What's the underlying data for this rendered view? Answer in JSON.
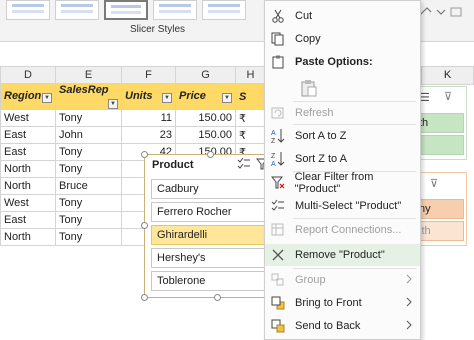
{
  "ribbon": {
    "group_label": "Slicer Styles"
  },
  "grid": {
    "columns": [
      "D",
      "E",
      "F",
      "G",
      "H"
    ],
    "headers": [
      "Region",
      "SalesRep",
      "Units",
      "Price",
      "S"
    ],
    "rows": [
      [
        "West",
        "Tony",
        "11",
        "150.00",
        "₹"
      ],
      [
        "East",
        "John",
        "23",
        "150.00",
        "₹"
      ],
      [
        "East",
        "Tony",
        "42",
        "150.00",
        "₹"
      ],
      [
        "North",
        "Tony",
        "",
        "",
        ""
      ],
      [
        "North",
        "Bruce",
        "",
        "",
        ""
      ],
      [
        "West",
        "Tony",
        "",
        "",
        ""
      ],
      [
        "East",
        "Tony",
        "",
        "",
        ""
      ],
      [
        "North",
        "Tony",
        "",
        "",
        ""
      ]
    ]
  },
  "right_grid": {
    "column": "K"
  },
  "right_slicers": {
    "green_item": "th",
    "orange_item1": "ny",
    "orange_item2": "ith"
  },
  "slicer": {
    "title": "Product",
    "items": [
      "Cadbury",
      "Ferrero Rocher",
      "Ghirardelli",
      "Hershey's",
      "Toblerone"
    ],
    "selected": "Ghirardelli"
  },
  "context_menu": {
    "cut": "Cut",
    "copy": "Copy",
    "paste_options": "Paste Options:",
    "refresh": "Refresh",
    "sort_a_z": "Sort A to Z",
    "sort_z_a": "Sort Z to A",
    "clear_filter": "Clear Filter from \"Product\"",
    "multi_select": "Multi-Select \"Product\"",
    "report_connections": "Report Connections...",
    "remove": "Remove \"Product\"",
    "group": "Group",
    "bring_to_front": "Bring to Front",
    "send_to_back": "Send to Back"
  },
  "colors": {
    "header_fill": "#ffd966",
    "selected_item": "#ffe699",
    "menu_hover": "#e5f1e4",
    "green_slicer": "#c6e6c3",
    "orange_slicer": "#f8cfae"
  }
}
